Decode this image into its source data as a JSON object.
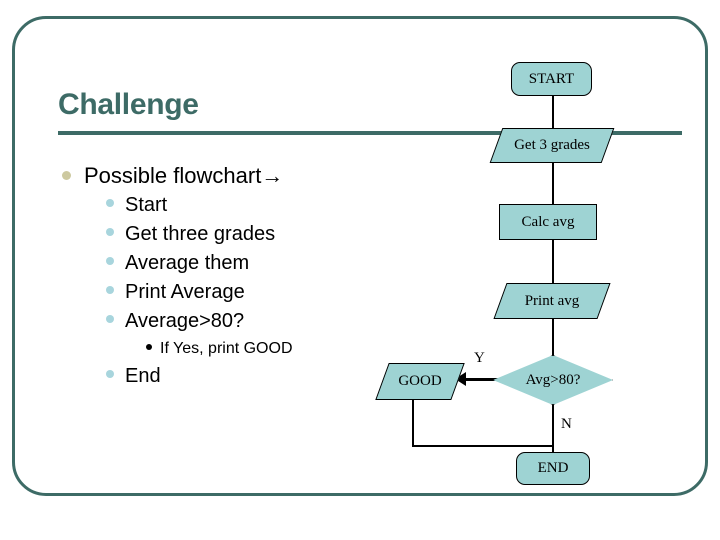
{
  "slide": {
    "title": "Challenge",
    "accent_color": "#3d6b66",
    "node_fill": "#9ed3d3",
    "bullet_l1_color": "#cdc9a0",
    "bullet_l2_color": "#a8d5dd"
  },
  "bullets": [
    {
      "level": 1,
      "text": "Possible flowchart→"
    },
    {
      "level": 2,
      "text": "Start"
    },
    {
      "level": 2,
      "text": "Get three grades"
    },
    {
      "level": 2,
      "text": "Average them"
    },
    {
      "level": 2,
      "text": "Print Average"
    },
    {
      "level": 2,
      "text": "Average>80?"
    },
    {
      "level": 3,
      "text": "If Yes, print GOOD"
    },
    {
      "level": 2,
      "text": "End"
    }
  ],
  "flowchart": {
    "nodes": {
      "start": "START",
      "get_grades": "Get 3 grades",
      "calc_avg": "Calc avg",
      "print_avg": "Print avg",
      "decision": "Avg>80?",
      "good": "GOOD",
      "end": "END"
    },
    "edge_labels": {
      "yes": "Y",
      "no": "N"
    }
  }
}
